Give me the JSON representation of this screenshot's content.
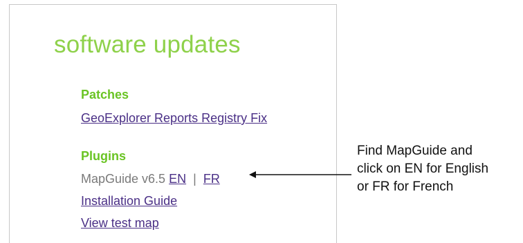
{
  "panel": {
    "title": "software updates",
    "patches": {
      "heading": "Patches",
      "links": [
        "GeoExplorer Reports Registry Fix"
      ]
    },
    "plugins": {
      "heading": "Plugins",
      "mapguide_label": "MapGuide v6.5",
      "en_link": "EN",
      "separator": "|",
      "fr_link": "FR",
      "links": [
        "Installation Guide",
        "View test map"
      ]
    }
  },
  "annotation": {
    "lines": [
      "Find MapGuide and",
      "click on EN for English",
      "or FR for French"
    ]
  },
  "colors": {
    "title_green": "#8ed14a",
    "heading_green": "#6ac424",
    "link_purple": "#4a2f86",
    "muted_gray": "#7a7a7a"
  },
  "icons": {
    "annotation_arrow": "left-arrow-icon"
  }
}
